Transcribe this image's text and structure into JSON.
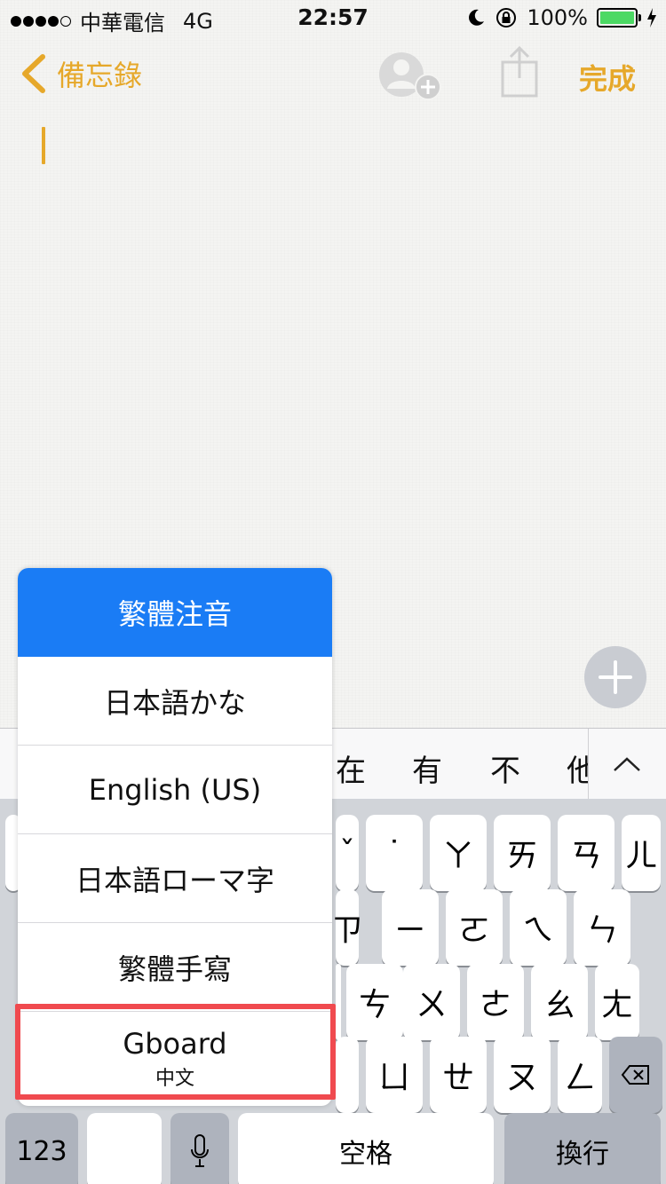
{
  "status_bar": {
    "carrier": "中華電信",
    "network": "4G",
    "time": "22:57",
    "battery": "100%"
  },
  "nav": {
    "back_label": "備忘錄",
    "done_label": "完成"
  },
  "colors": {
    "accent": "#e6a82a",
    "selected": "#1a7cf5",
    "highlight": "#f04a4f",
    "battery": "#4cd964"
  },
  "keyboard": {
    "candidates": [
      "在",
      "有",
      "不",
      "他"
    ],
    "row1": [
      "ˇ",
      "˙",
      "ㄚ",
      "ㄞ",
      "ㄢ",
      "ㄦ"
    ],
    "row2": [
      "ㄗ",
      "ㄧ",
      "ㄛ",
      "ㄟ",
      "ㄣ"
    ],
    "row3": [
      "ㄘ",
      "ㄨ",
      "ㄜ",
      "ㄠ",
      "ㄤ"
    ],
    "row4": [
      "ㄙ",
      "ㄩ",
      "ㄝ",
      "ㄡ",
      "ㄥ"
    ],
    "numbers_key": "123",
    "space_key": "空格",
    "return_key": "換行"
  },
  "language_menu": {
    "items": [
      {
        "label": "繁體注音",
        "sub": ""
      },
      {
        "label": "日本語かな",
        "sub": ""
      },
      {
        "label": "English (US)",
        "sub": ""
      },
      {
        "label": "日本語ローマ字",
        "sub": ""
      },
      {
        "label": "繁體手寫",
        "sub": ""
      },
      {
        "label": "Gboard",
        "sub": "中文"
      }
    ],
    "selected_index": 0,
    "highlighted_index": 5
  }
}
